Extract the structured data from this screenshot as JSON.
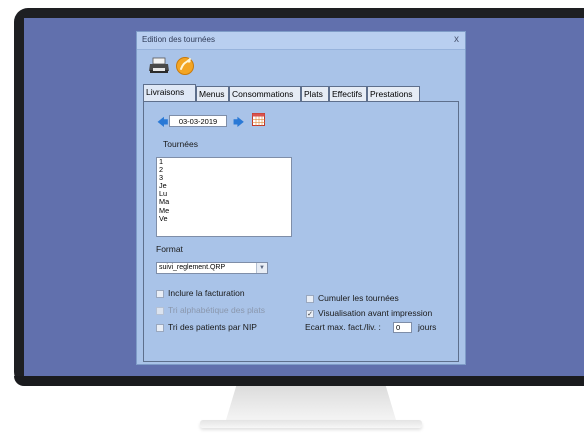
{
  "dialog": {
    "title": "Edition des tournées",
    "close_glyph": "x"
  },
  "toolbar": {
    "print_icon": "printer-icon",
    "run_icon": "play-icon"
  },
  "tabs": [
    {
      "label": "Livraisons",
      "active": true
    },
    {
      "label": "Menus"
    },
    {
      "label": "Consommations"
    },
    {
      "label": "Plats"
    },
    {
      "label": "Effectifs"
    },
    {
      "label": "Prestations"
    }
  ],
  "date": {
    "value": "03-03-2019",
    "prev_arrow": "🡄",
    "next_arrow": "🡆"
  },
  "tournees": {
    "label": "Tournées",
    "items": [
      "1",
      "2",
      "3",
      "Je",
      "Lu",
      "Ma",
      "Me",
      "Ve"
    ]
  },
  "format": {
    "label": "Format",
    "selected": "suivi_reglement.QRP"
  },
  "options": {
    "inclure_facturation": {
      "label": "Inclure la facturation",
      "checked": false
    },
    "tri_alphabetique": {
      "label": "Tri alphabétique des plats",
      "checked": false,
      "disabled": true
    },
    "tri_patients": {
      "label": "Tri des patients par NIP",
      "checked": false
    },
    "cumuler_tournees": {
      "label": "Cumuler les tournées",
      "checked": false
    },
    "visualisation": {
      "label": "Visualisation avant impression",
      "checked": true,
      "mark": "✓"
    },
    "ecart": {
      "label": "Ecart max. fact./liv. :",
      "value": "0",
      "unit": "jours"
    }
  },
  "colors": {
    "desktop": "#6170ad",
    "dialog_bg": "#a9c3e8",
    "arrow": "#2a79d6"
  }
}
